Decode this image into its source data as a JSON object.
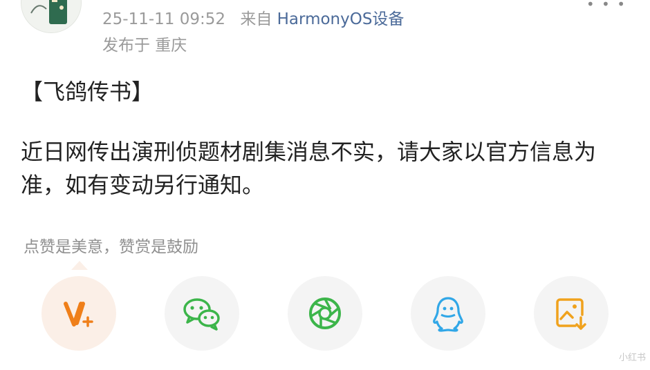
{
  "header": {
    "time": "25-11-11 09:52",
    "source_prefix": "来自",
    "device": "HarmonyOS设备",
    "location": "发布于 重庆"
  },
  "post": {
    "tag": "【飞鸽传书】",
    "body": "近日网传出演刑侦题材剧集消息不实，请大家以官方信息为准，如有变动另行通知。"
  },
  "reward": {
    "tip": "点赞是美意，赞赏是鼓励"
  },
  "share": {
    "items": [
      {
        "icon": "v-plus-icon",
        "color": "#ef7f1a"
      },
      {
        "icon": "wechat-icon",
        "color": "#3cb54a"
      },
      {
        "icon": "moments-icon",
        "color": "#3cb54a"
      },
      {
        "icon": "qq-icon",
        "color": "#31a7e7"
      },
      {
        "icon": "save-image-icon",
        "color": "#f0a21d"
      }
    ]
  },
  "watermark": "小红书"
}
